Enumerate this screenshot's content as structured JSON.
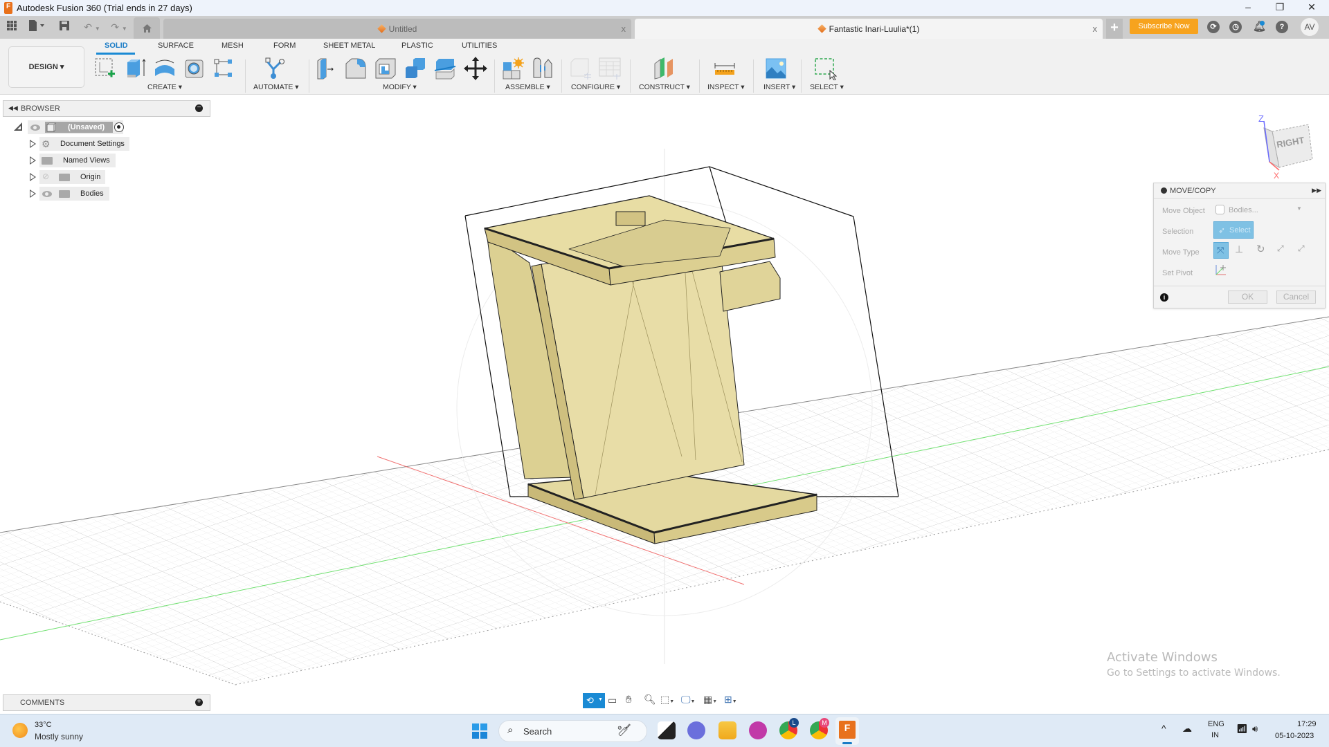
{
  "window": {
    "title": "Autodesk Fusion 360 (Trial ends in 27 days)",
    "controls": {
      "minimize": "–",
      "restore": "❐",
      "close": "✕"
    }
  },
  "tabs": [
    {
      "label": "Untitled",
      "active": false,
      "close": "x"
    },
    {
      "label": "Fantastic Inari-Luulia*(1)",
      "active": true,
      "close": "x"
    }
  ],
  "header": {
    "new_tab": "+",
    "subscribe_label": "Subscribe Now",
    "avatar_initials": "AV",
    "icons": [
      "extensions-icon",
      "job-status-icon",
      "notifications-icon",
      "help-icon"
    ],
    "accent_color": "#f7a31e"
  },
  "ribbon": {
    "workspace_label": "DESIGN ▾",
    "tabs": [
      "SOLID",
      "SURFACE",
      "MESH",
      "FORM",
      "SHEET METAL",
      "PLASTIC",
      "UTILITIES"
    ],
    "active_tab": "SOLID",
    "groups": [
      {
        "label": "CREATE ▾",
        "tools": [
          "create-sketch",
          "extrude",
          "revolve",
          "hole",
          "pattern"
        ]
      },
      {
        "label": "AUTOMATE ▾",
        "tools": [
          "automate"
        ]
      },
      {
        "label": "MODIFY ▾",
        "tools": [
          "press-pull",
          "fillet",
          "shell",
          "combine",
          "split-body",
          "move-copy"
        ]
      },
      {
        "label": "ASSEMBLE ▾",
        "tools": [
          "new-component",
          "joint"
        ]
      },
      {
        "label": "CONFIGURE ▾",
        "tools": [
          "configure",
          "configuration-table"
        ]
      },
      {
        "label": "CONSTRUCT ▾",
        "tools": [
          "offset-plane"
        ]
      },
      {
        "label": "INSPECT ▾",
        "tools": [
          "measure"
        ]
      },
      {
        "label": "INSERT ▾",
        "tools": [
          "insert-image"
        ]
      },
      {
        "label": "SELECT ▾",
        "tools": [
          "window-select"
        ]
      }
    ]
  },
  "browser": {
    "title": "BROWSER",
    "root": "(Unsaved)",
    "items": [
      {
        "label": "Document Settings",
        "icon": "gear"
      },
      {
        "label": "Named Views",
        "icon": "folder"
      },
      {
        "label": "Origin",
        "icon": "folder",
        "visible": false
      },
      {
        "label": "Bodies",
        "icon": "folder",
        "visible": true
      }
    ]
  },
  "viewcube": {
    "face": "RIGHT",
    "axis_z": "Z",
    "axis_x": "X"
  },
  "move_copy": {
    "title": "MOVE/COPY",
    "rows": [
      {
        "label": "Move Object",
        "value": "Bodies..."
      },
      {
        "label": "Selection",
        "value": "Select"
      },
      {
        "label": "Move Type",
        "value": ""
      },
      {
        "label": "Set Pivot",
        "value": ""
      }
    ],
    "ok": "OK",
    "cancel": "Cancel"
  },
  "comments": {
    "title": "COMMENTS"
  },
  "watermark": {
    "line1": "Activate Windows",
    "line2": "Go to Settings to activate Windows."
  },
  "taskbar": {
    "weather_temp": "33°C",
    "weather_desc": "Mostly sunny",
    "search_placeholder": "Search",
    "lang1": "ENG",
    "lang2": "IN",
    "time": "17:29",
    "date": "05-10-2023"
  }
}
